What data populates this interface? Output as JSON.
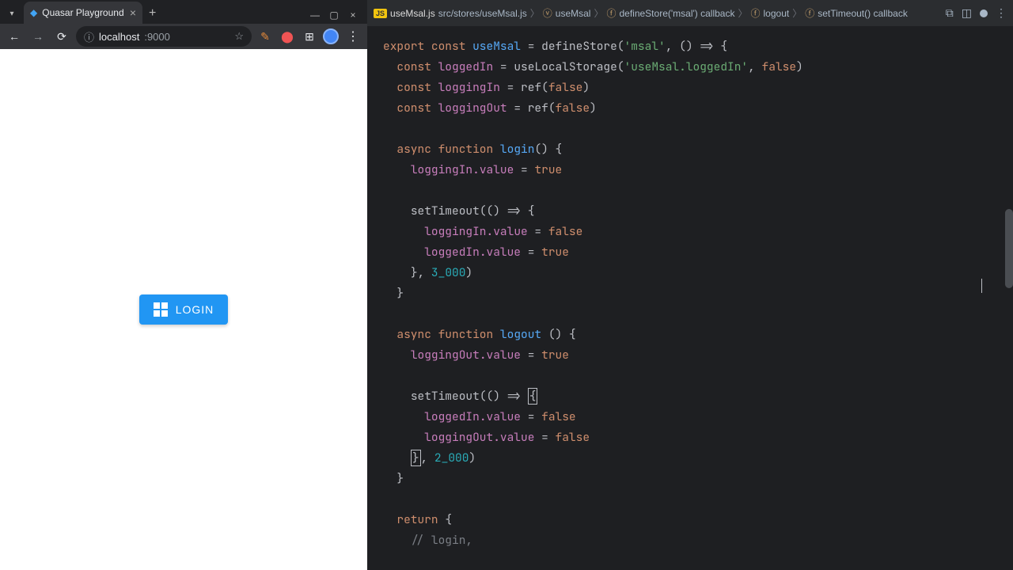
{
  "browser": {
    "tab_title": "Quasar Playground",
    "url_domain": "localhost",
    "url_port": ":9000",
    "login_button": "LOGIN"
  },
  "editor": {
    "filename": "useMsal.js",
    "crumbs": [
      "src/stores/useMsal.js",
      "useMsal",
      "defineStore('msal') callback",
      "logout",
      "setTimeout() callback"
    ]
  },
  "code": {
    "l1_export": "export",
    "l1_const": "const",
    "l1_name": "useMsal",
    "l1_eq": "=",
    "l1_fn": "defineStore",
    "l1_str": "'msal'",
    "l1_tail": ", () => {",
    "l2_const": "const",
    "l2_name": "loggedIn",
    "l2_eq": "=",
    "l2_fn": "useLocalStorage",
    "l2_str": "'useMsal.loggedIn'",
    "l2_tail": ",",
    "l2_bool": "false",
    "l3_const": "const",
    "l3_name": "loggingIn",
    "l3_eq": "=",
    "l3_fn": "ref",
    "l3_bool": "false",
    "l4_const": "const",
    "l4_name": "loggingOut",
    "l4_eq": "=",
    "l4_fn": "ref",
    "l4_bool": "false",
    "l6_async": "async",
    "l6_function": "function",
    "l6_name": "login",
    "l6_tail": "() {",
    "l7_name": "loggingIn",
    "l7_prop": ".value",
    "l7_eq": "=",
    "l7_bool": "true",
    "l9_fn": "setTimeout",
    "l9_tail": "(() => {",
    "l10_name": "loggingIn",
    "l10_prop": ".value",
    "l10_eq": "=",
    "l10_bool": "false",
    "l11_name": "loggedIn",
    "l11_prop": ".value",
    "l11_eq": "=",
    "l11_bool": "true",
    "l12_close": "},",
    "l12_num": "3_000",
    "l12_paren": ")",
    "l13_close": "}",
    "l15_async": "async",
    "l15_function": "function",
    "l15_name": "logout",
    "l15_tail": "() {",
    "l16_name": "loggingOut",
    "l16_prop": ".value",
    "l16_eq": "=",
    "l16_bool": "true",
    "l18_fn": "setTimeout",
    "l18_tail": "(() =>",
    "l18_brace": "{",
    "l19_name": "loggedIn",
    "l19_prop": ".value",
    "l19_eq": "=",
    "l19_bool": "false",
    "l20_name": "loggingOut",
    "l20_prop": ".value",
    "l20_eq": "=",
    "l20_bool": "false",
    "l21_close": "}",
    "l21_comma": ",",
    "l21_num": "2_000",
    "l21_paren": ")",
    "l22_close": "}",
    "l24_return": "return",
    "l24_brace": "{",
    "l25_comment": "// login,"
  }
}
